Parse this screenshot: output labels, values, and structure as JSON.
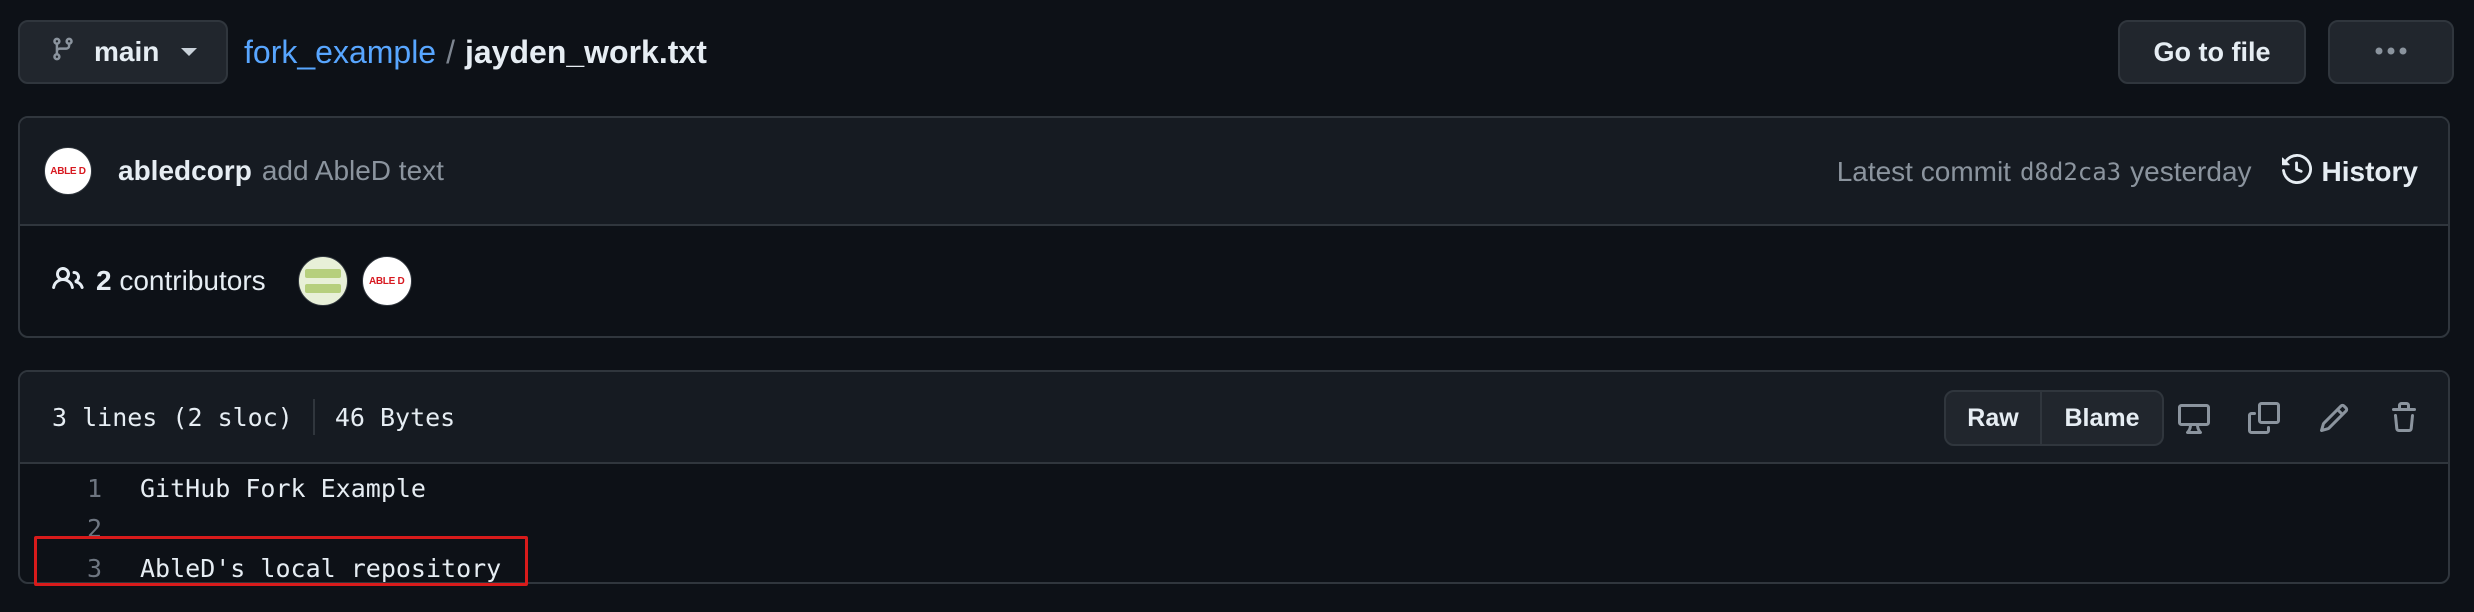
{
  "branch": {
    "name": "main",
    "icon": "git-branch-icon"
  },
  "breadcrumb": {
    "repo": "fork_example",
    "separator": "/",
    "file": "jayden_work.txt"
  },
  "actions": {
    "goto_file": "Go to file",
    "more_icon": "kebab-horizontal-icon"
  },
  "commit": {
    "avatar_logo": "ABLE D",
    "author": "abledcorp",
    "message": "add AbleD text",
    "latest_label": "Latest commit",
    "sha": "d8d2ca3",
    "time": "yesterday",
    "history_label": "History"
  },
  "contributors": {
    "count": "2",
    "label": "contributors"
  },
  "file": {
    "lines_info": "3 lines (2 sloc)",
    "size": "46 Bytes",
    "raw_label": "Raw",
    "blame_label": "Blame",
    "icons": [
      "desktop-icon",
      "copy-icon",
      "pencil-icon",
      "trash-icon"
    ],
    "lines": [
      {
        "num": "1",
        "text": "GitHub Fork Example"
      },
      {
        "num": "2",
        "text": ""
      },
      {
        "num": "3",
        "text": "AbleD's local repository"
      }
    ]
  },
  "colors": {
    "background": "#0d1117",
    "link": "#58a6ff",
    "highlight_border": "#d81b1b",
    "muted": "#8b949e"
  }
}
